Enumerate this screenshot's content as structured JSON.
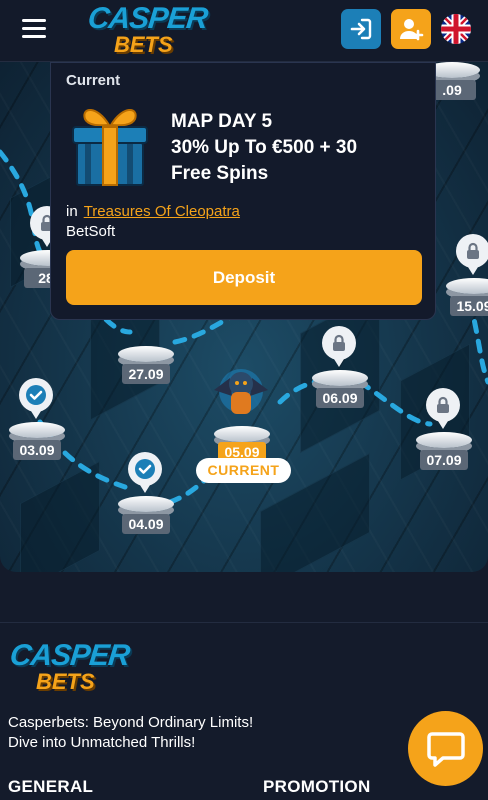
{
  "header": {
    "logo_top": "CASPER",
    "logo_bottom": "BETS",
    "login_icon": "login-icon",
    "signup_icon": "user-plus-icon",
    "language_icon": "uk-flag-icon"
  },
  "popup": {
    "current_label": "Current",
    "title_lines": [
      "MAP DAY 5",
      "30% Up To €500 + 30",
      "Free Spins"
    ],
    "in_label": "in",
    "game_link": "Treasures Of Cleopatra",
    "provider": "BetSoft",
    "deposit_label": "Deposit"
  },
  "map": {
    "partial_top_label": ".09",
    "nodes": [
      {
        "date": "28.",
        "status": "locked"
      },
      {
        "date": "27.09",
        "status": "locked"
      },
      {
        "date": "03.09",
        "status": "done"
      },
      {
        "date": "04.09",
        "status": "done"
      },
      {
        "date": "05.09",
        "status": "current"
      },
      {
        "date": "06.09",
        "status": "locked"
      },
      {
        "date": "07.09",
        "status": "locked"
      },
      {
        "date": "15.09",
        "status": "locked"
      }
    ],
    "current_tag": "CURRENT"
  },
  "footer": {
    "logo_top": "CASPER",
    "logo_bottom": "BETS",
    "tagline_line1": "Casperbets: Beyond Ordinary Limits!",
    "tagline_line2": "Dive into Unmatched Thrills!",
    "col1": "GENERAL",
    "col2": "PROMOTION"
  },
  "chat_icon": "chat-bubble-icon",
  "colors": {
    "accent": "#f5a31a",
    "brand_blue": "#1aa0d6",
    "background": "#141b2b"
  }
}
